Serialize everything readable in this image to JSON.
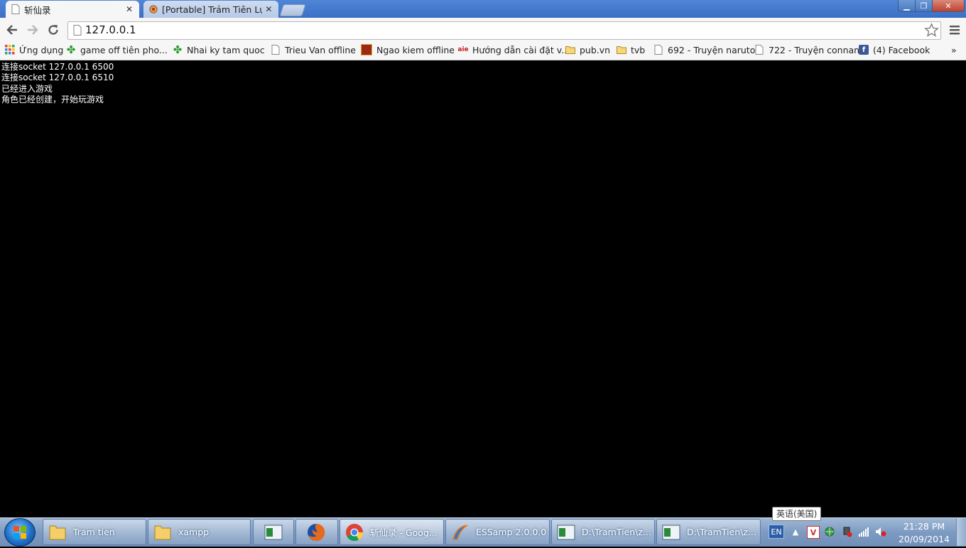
{
  "browser": {
    "tabs": [
      {
        "title": "斩仙录",
        "active": true
      },
      {
        "title": "[Portable] Trảm Tiên Lục",
        "active": false
      }
    ],
    "address": "127.0.0.1",
    "window_controls": {
      "minimize": "minimize",
      "maximize": "maximize",
      "close": "close"
    }
  },
  "bookmarks": [
    {
      "label": "Ứng dụng",
      "icon": "apps-grid-icon"
    },
    {
      "label": "game off tiên pho...",
      "icon": "clover-icon"
    },
    {
      "label": "Nhai ky tam quoc",
      "icon": "clover-icon"
    },
    {
      "label": "Trieu Van offline",
      "icon": "page-icon"
    },
    {
      "label": "Ngao kiem offline",
      "icon": "game-icon"
    },
    {
      "label": "Hướng dẫn cài đặt v...",
      "icon": "site-icon"
    },
    {
      "label": "pub.vn",
      "icon": "folder-icon"
    },
    {
      "label": "tvb",
      "icon": "folder-icon"
    },
    {
      "label": "692 - Truyện naruto",
      "icon": "page-icon"
    },
    {
      "label": "722 - Truyện connan",
      "icon": "page-icon"
    },
    {
      "label": "(4) Facebook",
      "icon": "facebook-icon"
    }
  ],
  "bookmarks_overflow": "»",
  "page": {
    "lines": [
      "连接socket 127.0.0.1 6500",
      "连接socket 127.0.0.1 6510",
      "已经进入游戏",
      "角色已经创建，开始玩游戏"
    ]
  },
  "taskbar": {
    "items": [
      {
        "label": "Tram tien",
        "icon": "folder-icon"
      },
      {
        "label": "xampp",
        "icon": "folder-icon"
      },
      {
        "label": "",
        "icon": "window-icon"
      },
      {
        "label": "",
        "icon": "firefox-icon"
      },
      {
        "label": "斩仙录 - Goog...",
        "icon": "chrome-icon"
      },
      {
        "label": "ESSamp 2.0.0.0",
        "icon": "essamp-icon"
      },
      {
        "label": "D:\\TramTien\\z...",
        "icon": "window-icon"
      },
      {
        "label": "D:\\TramTien\\z...",
        "icon": "window-icon"
      }
    ],
    "tooltip": "英语(美国)",
    "lang": "EN",
    "clock_time": "21:28 PM",
    "clock_date": "20/09/2014"
  },
  "colors": {
    "page_bg": "#000000",
    "page_text": "#ffffff",
    "titlebar": "#4f86d6"
  }
}
